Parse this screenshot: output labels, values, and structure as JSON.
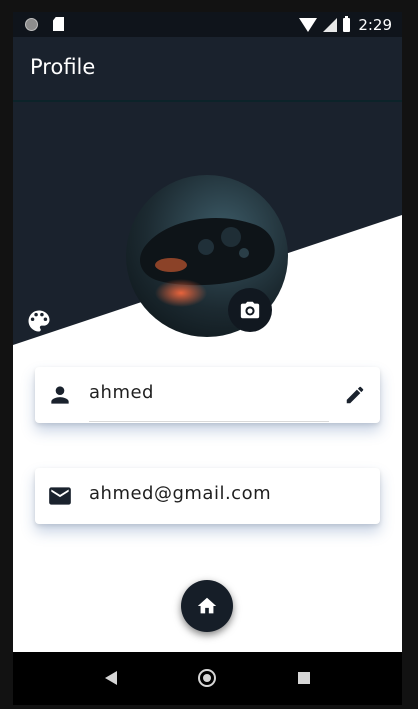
{
  "status_bar": {
    "time": "2:29",
    "icons": [
      "notification-dot-icon",
      "sd-card-icon",
      "wifi-icon",
      "signal-icon",
      "battery-icon"
    ]
  },
  "app_bar": {
    "title": "Profile"
  },
  "header": {
    "colors": {
      "dark": "#1a222d",
      "light": "#ffffff"
    },
    "palette_icon": "palette-icon"
  },
  "avatar": {
    "image": "game-controller-photo",
    "camera_icon": "camera-icon"
  },
  "profile": {
    "name": {
      "icon": "person-icon",
      "value": "ahmed",
      "edit_icon": "pencil-icon"
    },
    "email": {
      "icon": "mail-icon",
      "value": "ahmed@gmail.com"
    }
  },
  "fab": {
    "icon": "home-icon"
  },
  "nav_bar": {
    "icons": [
      "back-triangle-icon",
      "home-circle-icon",
      "recents-square-icon"
    ]
  }
}
